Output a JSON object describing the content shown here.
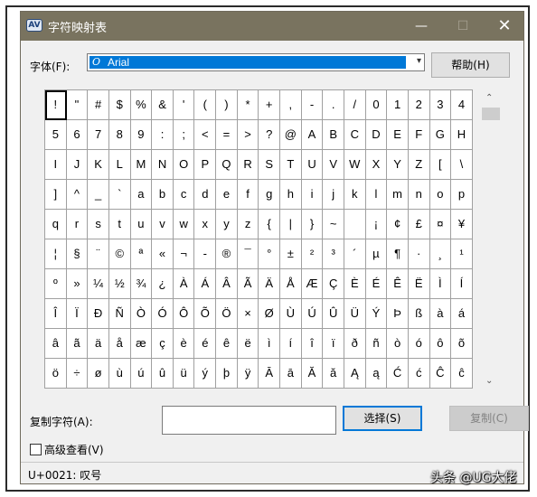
{
  "window": {
    "title": "字符映射表",
    "app_icon": "AV",
    "minimize": "—",
    "maximize": "☐",
    "close": "✕"
  },
  "font_label": "字体(F):",
  "font_select": {
    "value": "Arial",
    "icon": "O",
    "arrow": "▾"
  },
  "help_button": "帮助(H)",
  "characters": [
    "!",
    "\"",
    "#",
    "$",
    "%",
    "&",
    "'",
    "(",
    ")",
    "*",
    "+",
    ",",
    "-",
    ".",
    "/",
    "0",
    "1",
    "2",
    "3",
    "4",
    "5",
    "6",
    "7",
    "8",
    "9",
    ":",
    ";",
    "<",
    "=",
    ">",
    "?",
    "@",
    "A",
    "B",
    "C",
    "D",
    "E",
    "F",
    "G",
    "H",
    "I",
    "J",
    "K",
    "L",
    "M",
    "N",
    "O",
    "P",
    "Q",
    "R",
    "S",
    "T",
    "U",
    "V",
    "W",
    "X",
    "Y",
    "Z",
    "[",
    "\\",
    "]",
    "^",
    "_",
    "`",
    "a",
    "b",
    "c",
    "d",
    "e",
    "f",
    "g",
    "h",
    "i",
    "j",
    "k",
    "l",
    "m",
    "n",
    "o",
    "p",
    "q",
    "r",
    "s",
    "t",
    "u",
    "v",
    "w",
    "x",
    "y",
    "z",
    "{",
    "|",
    "}",
    "~",
    " ",
    "¡",
    "¢",
    "£",
    "¤",
    "¥",
    "¦",
    "§",
    "¨",
    "©",
    "ª",
    "«",
    "¬",
    "-",
    "®",
    "¯",
    "°",
    "±",
    "²",
    "³",
    "´",
    "µ",
    "¶",
    "·",
    "¸",
    "¹",
    "º",
    "»",
    "¼",
    "½",
    "¾",
    "¿",
    "À",
    "Á",
    "Â",
    "Ã",
    "Ä",
    "Å",
    "Æ",
    "Ç",
    "È",
    "É",
    "Ê",
    "Ë",
    "Ì",
    "Í",
    "Î",
    "Ï",
    "Ð",
    "Ñ",
    "Ò",
    "Ó",
    "Ô",
    "Õ",
    "Ö",
    "×",
    "Ø",
    "Ù",
    "Ú",
    "Û",
    "Ü",
    "Ý",
    "Þ",
    "ß",
    "à",
    "á",
    "â",
    "ã",
    "ä",
    "å",
    "æ",
    "ç",
    "è",
    "é",
    "ê",
    "ë",
    "ì",
    "í",
    "î",
    "ï",
    "ð",
    "ñ",
    "ò",
    "ó",
    "ô",
    "õ",
    "ö",
    "÷",
    "ø",
    "ù",
    "ú",
    "û",
    "ü",
    "ý",
    "þ",
    "ÿ",
    "Ā",
    "ā",
    "Ă",
    "ă",
    "Ą",
    "ą",
    "Ć",
    "ć",
    "Ĉ",
    "ĉ"
  ],
  "selected_index": 0,
  "scroll": {
    "up": "⌃",
    "down": "⌄"
  },
  "copy_label": "复制字符(A):",
  "copy_input_value": "",
  "select_button": "选择(S)",
  "copy_button": "复制(C)",
  "advanced_view": "高级查看(V)",
  "status": "U+0021: 叹号",
  "watermark": "头条 @UG大佬"
}
